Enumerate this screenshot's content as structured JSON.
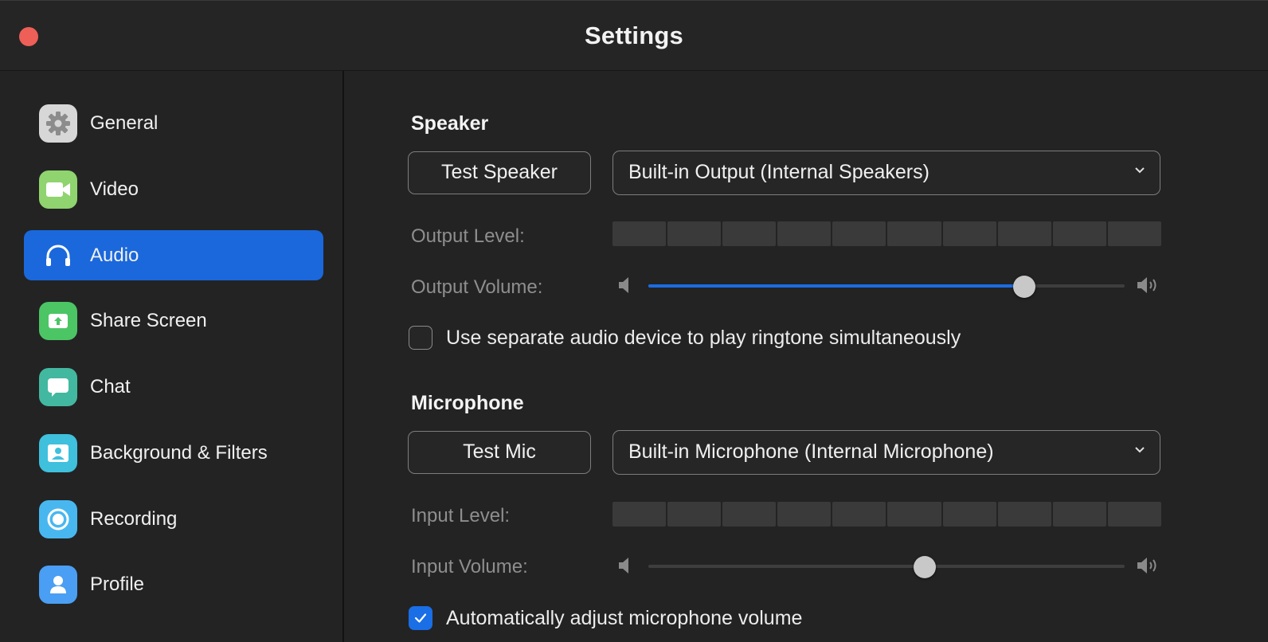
{
  "window": {
    "title": "Settings"
  },
  "sidebar": {
    "active": "Audio",
    "items": [
      {
        "label": "General",
        "icon": "gear-icon",
        "color": "#d7d7d7"
      },
      {
        "label": "Video",
        "icon": "video-camera-icon",
        "color": "#8fd46e"
      },
      {
        "label": "Audio",
        "icon": "headphones-icon",
        "color": "#1a68dc"
      },
      {
        "label": "Share Screen",
        "icon": "share-screen-icon",
        "color": "#4cc565"
      },
      {
        "label": "Chat",
        "icon": "chat-bubble-icon",
        "color": "#43b8a0"
      },
      {
        "label": "Background & Filters",
        "icon": "portrait-icon",
        "color": "#3fc0dd"
      },
      {
        "label": "Recording",
        "icon": "record-icon",
        "color": "#48b7f0"
      },
      {
        "label": "Profile",
        "icon": "person-icon",
        "color": "#4a9ef3"
      }
    ]
  },
  "speaker": {
    "title": "Speaker",
    "test_button": "Test Speaker",
    "device": "Built-in Output (Internal Speakers)",
    "output_level_label": "Output Level:",
    "output_volume_label": "Output Volume:",
    "output_volume": 0.79,
    "separate_device_label": "Use separate audio device to play ringtone simultaneously",
    "separate_device_checked": false
  },
  "microphone": {
    "title": "Microphone",
    "test_button": "Test Mic",
    "device": "Built-in Microphone (Internal Microphone)",
    "input_level_label": "Input Level:",
    "input_volume_label": "Input Volume:",
    "input_volume": 0.58,
    "auto_adjust_label": "Automatically adjust microphone volume",
    "auto_adjust_checked": true
  },
  "colors": {
    "accent": "#1a68dc",
    "close_button": "#ee5f57",
    "background": "#232323"
  }
}
